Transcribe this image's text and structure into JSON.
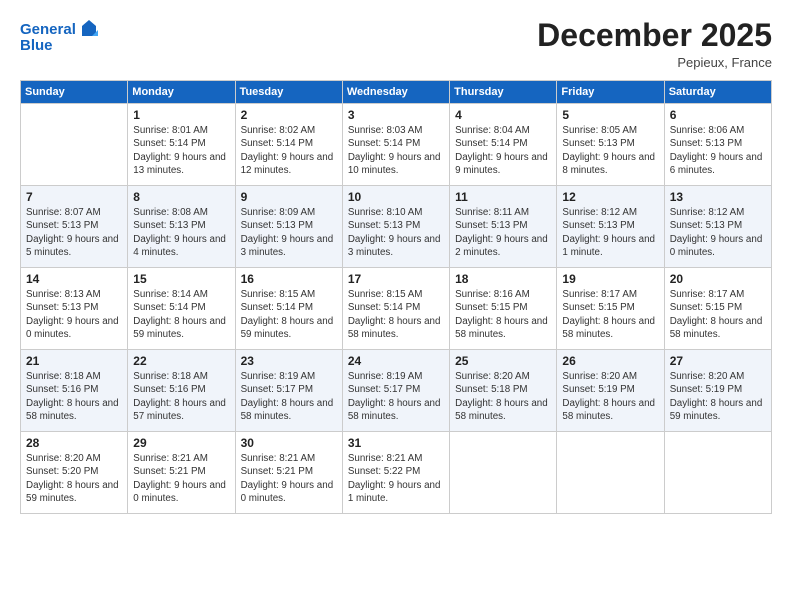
{
  "header": {
    "logo_line1": "General",
    "logo_line2": "Blue",
    "month": "December 2025",
    "location": "Pepieux, France"
  },
  "days_of_week": [
    "Sunday",
    "Monday",
    "Tuesday",
    "Wednesday",
    "Thursday",
    "Friday",
    "Saturday"
  ],
  "weeks": [
    [
      {
        "day": "",
        "sunrise": "",
        "sunset": "",
        "daylight": ""
      },
      {
        "day": "1",
        "sunrise": "Sunrise: 8:01 AM",
        "sunset": "Sunset: 5:14 PM",
        "daylight": "Daylight: 9 hours and 13 minutes."
      },
      {
        "day": "2",
        "sunrise": "Sunrise: 8:02 AM",
        "sunset": "Sunset: 5:14 PM",
        "daylight": "Daylight: 9 hours and 12 minutes."
      },
      {
        "day": "3",
        "sunrise": "Sunrise: 8:03 AM",
        "sunset": "Sunset: 5:14 PM",
        "daylight": "Daylight: 9 hours and 10 minutes."
      },
      {
        "day": "4",
        "sunrise": "Sunrise: 8:04 AM",
        "sunset": "Sunset: 5:14 PM",
        "daylight": "Daylight: 9 hours and 9 minutes."
      },
      {
        "day": "5",
        "sunrise": "Sunrise: 8:05 AM",
        "sunset": "Sunset: 5:13 PM",
        "daylight": "Daylight: 9 hours and 8 minutes."
      },
      {
        "day": "6",
        "sunrise": "Sunrise: 8:06 AM",
        "sunset": "Sunset: 5:13 PM",
        "daylight": "Daylight: 9 hours and 6 minutes."
      }
    ],
    [
      {
        "day": "7",
        "sunrise": "Sunrise: 8:07 AM",
        "sunset": "Sunset: 5:13 PM",
        "daylight": "Daylight: 9 hours and 5 minutes."
      },
      {
        "day": "8",
        "sunrise": "Sunrise: 8:08 AM",
        "sunset": "Sunset: 5:13 PM",
        "daylight": "Daylight: 9 hours and 4 minutes."
      },
      {
        "day": "9",
        "sunrise": "Sunrise: 8:09 AM",
        "sunset": "Sunset: 5:13 PM",
        "daylight": "Daylight: 9 hours and 3 minutes."
      },
      {
        "day": "10",
        "sunrise": "Sunrise: 8:10 AM",
        "sunset": "Sunset: 5:13 PM",
        "daylight": "Daylight: 9 hours and 3 minutes."
      },
      {
        "day": "11",
        "sunrise": "Sunrise: 8:11 AM",
        "sunset": "Sunset: 5:13 PM",
        "daylight": "Daylight: 9 hours and 2 minutes."
      },
      {
        "day": "12",
        "sunrise": "Sunrise: 8:12 AM",
        "sunset": "Sunset: 5:13 PM",
        "daylight": "Daylight: 9 hours and 1 minute."
      },
      {
        "day": "13",
        "sunrise": "Sunrise: 8:12 AM",
        "sunset": "Sunset: 5:13 PM",
        "daylight": "Daylight: 9 hours and 0 minutes."
      }
    ],
    [
      {
        "day": "14",
        "sunrise": "Sunrise: 8:13 AM",
        "sunset": "Sunset: 5:13 PM",
        "daylight": "Daylight: 9 hours and 0 minutes."
      },
      {
        "day": "15",
        "sunrise": "Sunrise: 8:14 AM",
        "sunset": "Sunset: 5:14 PM",
        "daylight": "Daylight: 8 hours and 59 minutes."
      },
      {
        "day": "16",
        "sunrise": "Sunrise: 8:15 AM",
        "sunset": "Sunset: 5:14 PM",
        "daylight": "Daylight: 8 hours and 59 minutes."
      },
      {
        "day": "17",
        "sunrise": "Sunrise: 8:15 AM",
        "sunset": "Sunset: 5:14 PM",
        "daylight": "Daylight: 8 hours and 58 minutes."
      },
      {
        "day": "18",
        "sunrise": "Sunrise: 8:16 AM",
        "sunset": "Sunset: 5:15 PM",
        "daylight": "Daylight: 8 hours and 58 minutes."
      },
      {
        "day": "19",
        "sunrise": "Sunrise: 8:17 AM",
        "sunset": "Sunset: 5:15 PM",
        "daylight": "Daylight: 8 hours and 58 minutes."
      },
      {
        "day": "20",
        "sunrise": "Sunrise: 8:17 AM",
        "sunset": "Sunset: 5:15 PM",
        "daylight": "Daylight: 8 hours and 58 minutes."
      }
    ],
    [
      {
        "day": "21",
        "sunrise": "Sunrise: 8:18 AM",
        "sunset": "Sunset: 5:16 PM",
        "daylight": "Daylight: 8 hours and 58 minutes."
      },
      {
        "day": "22",
        "sunrise": "Sunrise: 8:18 AM",
        "sunset": "Sunset: 5:16 PM",
        "daylight": "Daylight: 8 hours and 57 minutes."
      },
      {
        "day": "23",
        "sunrise": "Sunrise: 8:19 AM",
        "sunset": "Sunset: 5:17 PM",
        "daylight": "Daylight: 8 hours and 58 minutes."
      },
      {
        "day": "24",
        "sunrise": "Sunrise: 8:19 AM",
        "sunset": "Sunset: 5:17 PM",
        "daylight": "Daylight: 8 hours and 58 minutes."
      },
      {
        "day": "25",
        "sunrise": "Sunrise: 8:20 AM",
        "sunset": "Sunset: 5:18 PM",
        "daylight": "Daylight: 8 hours and 58 minutes."
      },
      {
        "day": "26",
        "sunrise": "Sunrise: 8:20 AM",
        "sunset": "Sunset: 5:19 PM",
        "daylight": "Daylight: 8 hours and 58 minutes."
      },
      {
        "day": "27",
        "sunrise": "Sunrise: 8:20 AM",
        "sunset": "Sunset: 5:19 PM",
        "daylight": "Daylight: 8 hours and 59 minutes."
      }
    ],
    [
      {
        "day": "28",
        "sunrise": "Sunrise: 8:20 AM",
        "sunset": "Sunset: 5:20 PM",
        "daylight": "Daylight: 8 hours and 59 minutes."
      },
      {
        "day": "29",
        "sunrise": "Sunrise: 8:21 AM",
        "sunset": "Sunset: 5:21 PM",
        "daylight": "Daylight: 9 hours and 0 minutes."
      },
      {
        "day": "30",
        "sunrise": "Sunrise: 8:21 AM",
        "sunset": "Sunset: 5:21 PM",
        "daylight": "Daylight: 9 hours and 0 minutes."
      },
      {
        "day": "31",
        "sunrise": "Sunrise: 8:21 AM",
        "sunset": "Sunset: 5:22 PM",
        "daylight": "Daylight: 9 hours and 1 minute."
      },
      {
        "day": "",
        "sunrise": "",
        "sunset": "",
        "daylight": ""
      },
      {
        "day": "",
        "sunrise": "",
        "sunset": "",
        "daylight": ""
      },
      {
        "day": "",
        "sunrise": "",
        "sunset": "",
        "daylight": ""
      }
    ]
  ]
}
